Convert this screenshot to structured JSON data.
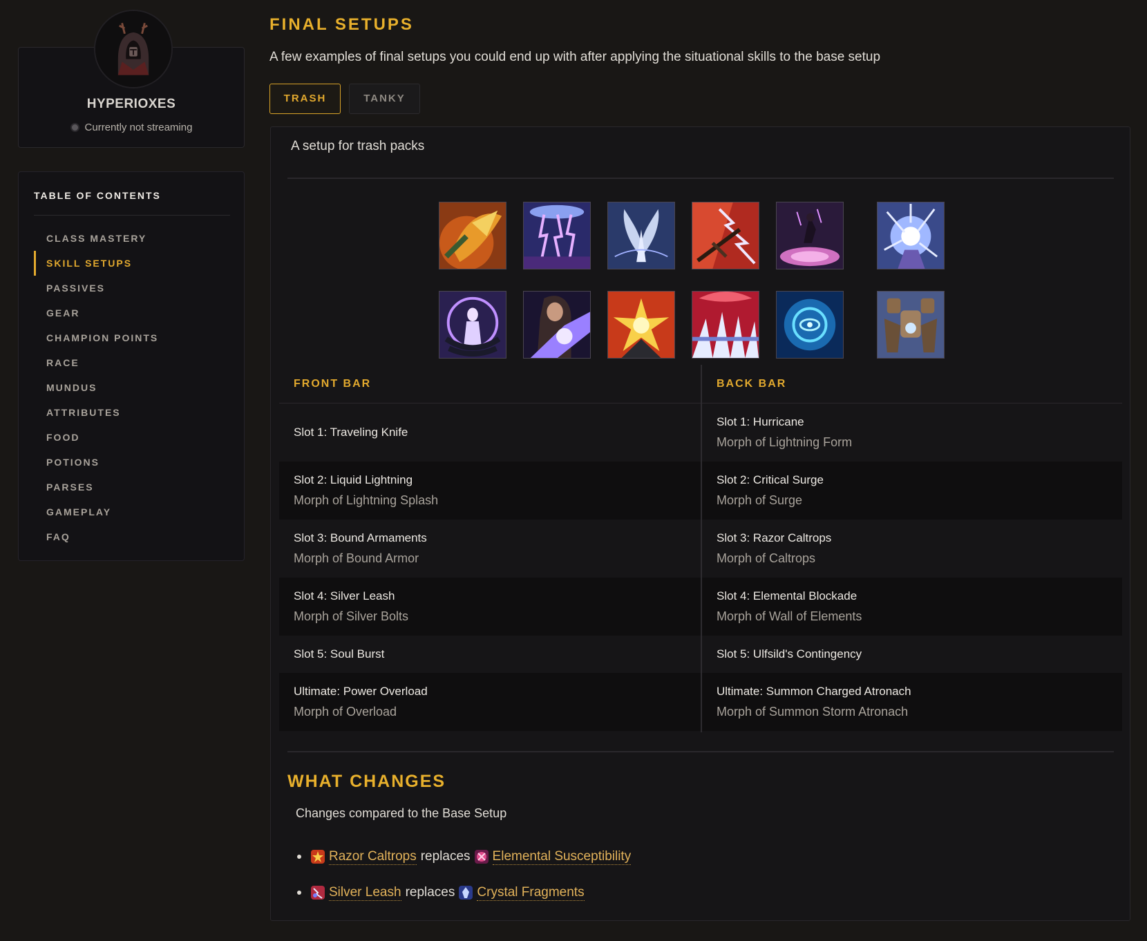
{
  "profile": {
    "name": "HYPERIOXES",
    "stream_status": "Currently not streaming"
  },
  "toc": {
    "title": "TABLE OF CONTENTS",
    "items": [
      {
        "label": "CLASS MASTERY",
        "active": false
      },
      {
        "label": "SKILL SETUPS",
        "active": true
      },
      {
        "label": "PASSIVES",
        "active": false
      },
      {
        "label": "GEAR",
        "active": false
      },
      {
        "label": "CHAMPION POINTS",
        "active": false
      },
      {
        "label": "RACE",
        "active": false
      },
      {
        "label": "MUNDUS",
        "active": false
      },
      {
        "label": "ATTRIBUTES",
        "active": false
      },
      {
        "label": "FOOD",
        "active": false
      },
      {
        "label": "POTIONS",
        "active": false
      },
      {
        "label": "PARSES",
        "active": false
      },
      {
        "label": "GAMEPLAY",
        "active": false
      },
      {
        "label": "FAQ",
        "active": false
      }
    ]
  },
  "main": {
    "title": "FINAL SETUPS",
    "intro": "A few examples of final setups you could end up with after applying the situational skills to the base setup",
    "tabs": [
      "TRASH",
      "TANKY"
    ],
    "active_tab": "TRASH",
    "setup_description": "A setup for trash packs",
    "skill_icons": {
      "front": [
        "traveling-knife-icon",
        "liquid-lightning-icon",
        "bound-armaments-icon",
        "silver-leash-icon",
        "soul-burst-icon",
        "power-overload-icon"
      ],
      "back": [
        "hurricane-icon",
        "critical-surge-icon",
        "razor-caltrops-icon",
        "elemental-blockade-icon",
        "ulfsilds-contingency-icon",
        "summon-charged-atronach-icon"
      ]
    },
    "front_bar": {
      "heading": "FRONT BAR",
      "slots": [
        {
          "name": "Slot 1: Traveling Knife",
          "morph": ""
        },
        {
          "name": "Slot 2: Liquid Lightning",
          "morph": "Morph of Lightning Splash"
        },
        {
          "name": "Slot 3: Bound Armaments",
          "morph": "Morph of Bound Armor"
        },
        {
          "name": "Slot 4: Silver Leash",
          "morph": "Morph of Silver Bolts"
        },
        {
          "name": "Slot 5: Soul Burst",
          "morph": ""
        },
        {
          "name": "Ultimate: Power Overload",
          "morph": "Morph of Overload"
        }
      ]
    },
    "back_bar": {
      "heading": "BACK BAR",
      "slots": [
        {
          "name": "Slot 1: Hurricane",
          "morph": "Morph of Lightning Form"
        },
        {
          "name": "Slot 2: Critical Surge",
          "morph": "Morph of Surge"
        },
        {
          "name": "Slot 3: Razor Caltrops",
          "morph": "Morph of Caltrops"
        },
        {
          "name": "Slot 4: Elemental Blockade",
          "morph": "Morph of Wall of Elements"
        },
        {
          "name": "Slot 5: Ulfsild's Contingency",
          "morph": ""
        },
        {
          "name": "Ultimate: Summon Charged Atronach",
          "morph": "Morph of Summon Storm Atronach"
        }
      ]
    },
    "changes": {
      "title": "WHAT CHANGES",
      "subtitle": "Changes compared to the Base Setup",
      "items": [
        {
          "new": "Razor Caltrops",
          "verb": "replaces",
          "old": "Elemental Susceptibility"
        },
        {
          "new": "Silver Leash",
          "verb": "replaces",
          "old": "Crystal Fragments"
        }
      ]
    }
  },
  "colors": {
    "accent": "#e2a92e",
    "background": "#191715",
    "panel": "#161517"
  }
}
